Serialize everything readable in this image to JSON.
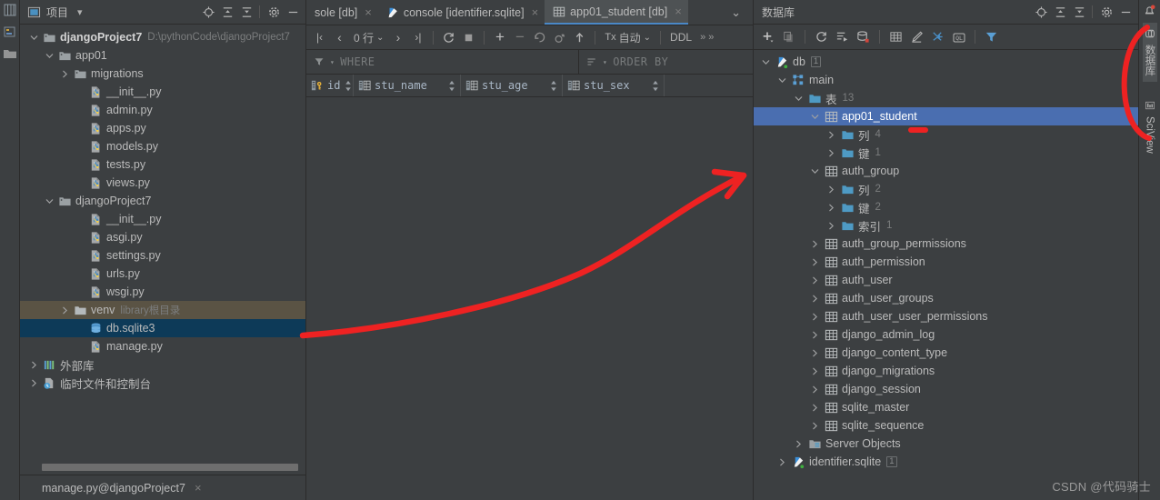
{
  "project_panel": {
    "title": "项目",
    "header_icons": [
      "locate-icon",
      "expand-all-icon",
      "collapse-all-icon",
      "gear-icon",
      "minimize-icon"
    ],
    "dropdown_caret": "▾",
    "tree": [
      {
        "label": "djangoProject7",
        "suffix": "D:\\pythonCode\\djangoProject7",
        "icon": "folder-project-icon",
        "indent": 0,
        "arrow": "down",
        "bold": true,
        "state": "normal"
      },
      {
        "label": "app01",
        "suffix": "",
        "icon": "folder-module-icon",
        "indent": 1,
        "arrow": "down",
        "bold": false,
        "state": "normal"
      },
      {
        "label": "migrations",
        "suffix": "",
        "icon": "folder-module-icon",
        "indent": 2,
        "arrow": "right",
        "bold": false,
        "state": "normal"
      },
      {
        "label": "__init__.py",
        "suffix": "",
        "icon": "python-file-icon",
        "indent": 3,
        "arrow": "none",
        "bold": false,
        "state": "normal"
      },
      {
        "label": "admin.py",
        "suffix": "",
        "icon": "python-file-icon",
        "indent": 3,
        "arrow": "none",
        "bold": false,
        "state": "normal"
      },
      {
        "label": "apps.py",
        "suffix": "",
        "icon": "python-file-icon",
        "indent": 3,
        "arrow": "none",
        "bold": false,
        "state": "normal"
      },
      {
        "label": "models.py",
        "suffix": "",
        "icon": "python-file-icon",
        "indent": 3,
        "arrow": "none",
        "bold": false,
        "state": "normal"
      },
      {
        "label": "tests.py",
        "suffix": "",
        "icon": "python-file-icon",
        "indent": 3,
        "arrow": "none",
        "bold": false,
        "state": "normal"
      },
      {
        "label": "views.py",
        "suffix": "",
        "icon": "python-file-icon",
        "indent": 3,
        "arrow": "none",
        "bold": false,
        "state": "normal"
      },
      {
        "label": "djangoProject7",
        "suffix": "",
        "icon": "folder-module-icon",
        "indent": 1,
        "arrow": "down",
        "bold": false,
        "state": "normal"
      },
      {
        "label": "__init__.py",
        "suffix": "",
        "icon": "python-file-icon",
        "indent": 3,
        "arrow": "none",
        "bold": false,
        "state": "normal"
      },
      {
        "label": "asgi.py",
        "suffix": "",
        "icon": "python-file-icon",
        "indent": 3,
        "arrow": "none",
        "bold": false,
        "state": "normal"
      },
      {
        "label": "settings.py",
        "suffix": "",
        "icon": "python-file-icon",
        "indent": 3,
        "arrow": "none",
        "bold": false,
        "state": "normal"
      },
      {
        "label": "urls.py",
        "suffix": "",
        "icon": "python-file-icon",
        "indent": 3,
        "arrow": "none",
        "bold": false,
        "state": "normal"
      },
      {
        "label": "wsgi.py",
        "suffix": "",
        "icon": "python-file-icon",
        "indent": 3,
        "arrow": "none",
        "bold": false,
        "state": "normal"
      },
      {
        "label": "venv",
        "suffix": "library根目录",
        "icon": "folder-plain-icon",
        "indent": 2,
        "arrow": "right",
        "bold": false,
        "state": "hover"
      },
      {
        "label": "db.sqlite3",
        "suffix": "",
        "icon": "database-file-icon",
        "indent": 3,
        "arrow": "none",
        "bold": false,
        "state": "selected"
      },
      {
        "label": "manage.py",
        "suffix": "",
        "icon": "python-file-icon",
        "indent": 3,
        "arrow": "none",
        "bold": false,
        "state": "normal"
      },
      {
        "label": "外部库",
        "suffix": "",
        "icon": "library-icon",
        "indent": 0,
        "arrow": "right",
        "bold": false,
        "state": "normal"
      },
      {
        "label": "临时文件和控制台",
        "suffix": "",
        "icon": "scratches-icon",
        "indent": 0,
        "arrow": "right",
        "bold": false,
        "state": "normal"
      }
    ],
    "bottom_tab": {
      "label": "manage.py@djangoProject7",
      "close": "×"
    }
  },
  "editor": {
    "tabs": [
      {
        "label": "sole [db]",
        "icon": "none",
        "active": false,
        "close": "×",
        "clipped": true
      },
      {
        "label": "console [identifier.sqlite]",
        "icon": "console-icon",
        "active": false,
        "close": "×",
        "clipped": false
      },
      {
        "label": "app01_student [db]",
        "icon": "table-icon",
        "active": true,
        "close": "×",
        "clipped": false
      }
    ],
    "tabbar_caret": "⌄",
    "toolbar": {
      "first_page": "|‹",
      "prev_page": "‹",
      "row_count": "0 行",
      "row_count_caret": "⌄",
      "next_page": "›",
      "last_page": "›|",
      "reload": "refresh-icon",
      "stop": "stop-icon",
      "add_row": "+",
      "delete_row": "−",
      "revert": "revert-icon",
      "rollback": "rollback-icon",
      "submit": "submit-icon",
      "tx_label": "Tx: 自动",
      "tx_prefix": "Tx",
      "tx_value": "自动",
      "tx_caret": "⌄",
      "ddl": "DDL",
      "overflow": "» »"
    },
    "filters": {
      "where": "WHERE",
      "order_by": "ORDER BY"
    },
    "columns": [
      {
        "name": "id",
        "icon": "primary-key-icon"
      },
      {
        "name": "stu_name",
        "icon": "column-icon"
      },
      {
        "name": "stu_age",
        "icon": "column-icon"
      },
      {
        "name": "stu_sex",
        "icon": "column-icon"
      }
    ],
    "rows": []
  },
  "database_panel": {
    "title": "数据库",
    "header_icons": [
      "locate-icon",
      "expand-all-icon",
      "collapse-all-icon",
      "gear-icon",
      "minimize-icon"
    ],
    "toolbar_icons": [
      "add-icon",
      "copy-icon",
      "refresh-icon",
      "run-script-icon",
      "sync-db-icon",
      "table-editor-icon",
      "modify-icon",
      "jump-to-icon",
      "query-console-icon",
      "filter-icon"
    ],
    "tree": [
      {
        "label": "db",
        "badge": "1",
        "icon": "datasource-icon",
        "indent": 0,
        "arrow": "down",
        "selected": false
      },
      {
        "label": "main",
        "badge": "",
        "icon": "schema-icon",
        "indent": 1,
        "arrow": "down",
        "selected": false
      },
      {
        "label": "表",
        "badge": "",
        "count": "13",
        "icon": "folder-db-icon",
        "indent": 2,
        "arrow": "down",
        "selected": false
      },
      {
        "label": "app01_student",
        "badge": "",
        "icon": "table-icon",
        "indent": 3,
        "arrow": "down",
        "selected": true
      },
      {
        "label": "列",
        "badge": "",
        "count": "4",
        "icon": "folder-db-icon",
        "indent": 4,
        "arrow": "right",
        "selected": false
      },
      {
        "label": "键",
        "badge": "",
        "count": "1",
        "icon": "folder-db-icon",
        "indent": 4,
        "arrow": "right",
        "selected": false
      },
      {
        "label": "auth_group",
        "badge": "",
        "icon": "table-icon",
        "indent": 3,
        "arrow": "down",
        "selected": false
      },
      {
        "label": "列",
        "badge": "",
        "count": "2",
        "icon": "folder-db-icon",
        "indent": 4,
        "arrow": "right",
        "selected": false
      },
      {
        "label": "键",
        "badge": "",
        "count": "2",
        "icon": "folder-db-icon",
        "indent": 4,
        "arrow": "right",
        "selected": false
      },
      {
        "label": "索引",
        "badge": "",
        "count": "1",
        "icon": "folder-db-icon",
        "indent": 4,
        "arrow": "right",
        "selected": false
      },
      {
        "label": "auth_group_permissions",
        "badge": "",
        "icon": "table-icon",
        "indent": 3,
        "arrow": "right",
        "selected": false
      },
      {
        "label": "auth_permission",
        "badge": "",
        "icon": "table-icon",
        "indent": 3,
        "arrow": "right",
        "selected": false
      },
      {
        "label": "auth_user",
        "badge": "",
        "icon": "table-icon",
        "indent": 3,
        "arrow": "right",
        "selected": false
      },
      {
        "label": "auth_user_groups",
        "badge": "",
        "icon": "table-icon",
        "indent": 3,
        "arrow": "right",
        "selected": false
      },
      {
        "label": "auth_user_user_permissions",
        "badge": "",
        "icon": "table-icon",
        "indent": 3,
        "arrow": "right",
        "selected": false
      },
      {
        "label": "django_admin_log",
        "badge": "",
        "icon": "table-icon",
        "indent": 3,
        "arrow": "right",
        "selected": false
      },
      {
        "label": "django_content_type",
        "badge": "",
        "icon": "table-icon",
        "indent": 3,
        "arrow": "right",
        "selected": false
      },
      {
        "label": "django_migrations",
        "badge": "",
        "icon": "table-icon",
        "indent": 3,
        "arrow": "right",
        "selected": false
      },
      {
        "label": "django_session",
        "badge": "",
        "icon": "table-icon",
        "indent": 3,
        "arrow": "right",
        "selected": false
      },
      {
        "label": "sqlite_master",
        "badge": "",
        "icon": "table-icon",
        "indent": 3,
        "arrow": "right",
        "selected": false
      },
      {
        "label": "sqlite_sequence",
        "badge": "",
        "icon": "table-icon",
        "indent": 3,
        "arrow": "right",
        "selected": false
      },
      {
        "label": "Server Objects",
        "badge": "",
        "icon": "server-objects-icon",
        "indent": 2,
        "arrow": "right",
        "selected": false
      },
      {
        "label": "identifier.sqlite",
        "badge": "1",
        "icon": "datasource-icon",
        "indent": 1,
        "arrow": "right",
        "selected": false
      }
    ]
  },
  "right_rail": {
    "notification_icon": "bell-icon",
    "tabs": [
      {
        "label": "数据库",
        "icon": "database-icon",
        "selected": true
      },
      {
        "label": "SciView",
        "icon": "sciview-icon",
        "selected": false
      }
    ]
  },
  "annotations": {
    "arrow_color": "#ee2222",
    "circle_color": "#ee2222",
    "dash_color": "#ee2222"
  },
  "watermark": "CSDN @代码骑士"
}
